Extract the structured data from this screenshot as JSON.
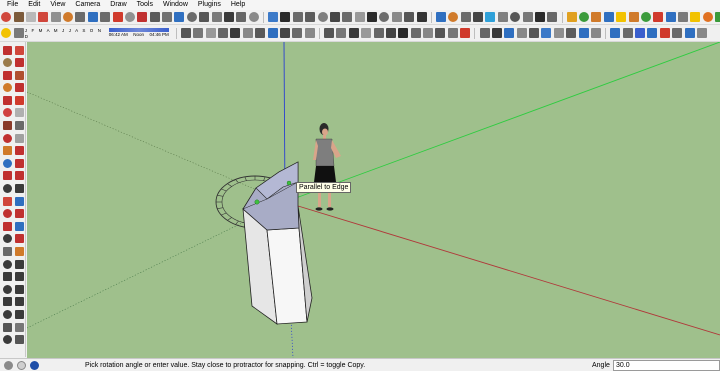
{
  "menu": [
    "File",
    "Edit",
    "View",
    "Camera",
    "Draw",
    "Tools",
    "Window",
    "Plugins",
    "Help"
  ],
  "shadow": {
    "months": "J F M A M J J A S O N D",
    "time_start": "06:42 AM",
    "time_noon": "Noon",
    "time_end": "04:46 PM"
  },
  "tooltip": "Parallel to Edge",
  "status": {
    "message": "Pick rotation angle or enter value.  Stay close to protractor for snapping. Ctrl = toggle Copy.",
    "measure_label": "Angle",
    "measure_value": "30.0"
  },
  "colors": {
    "sky": "#9fc08c",
    "red_axis": "#c0392b",
    "green_axis": "#2ecc40",
    "blue_axis": "#2a3fd1"
  }
}
